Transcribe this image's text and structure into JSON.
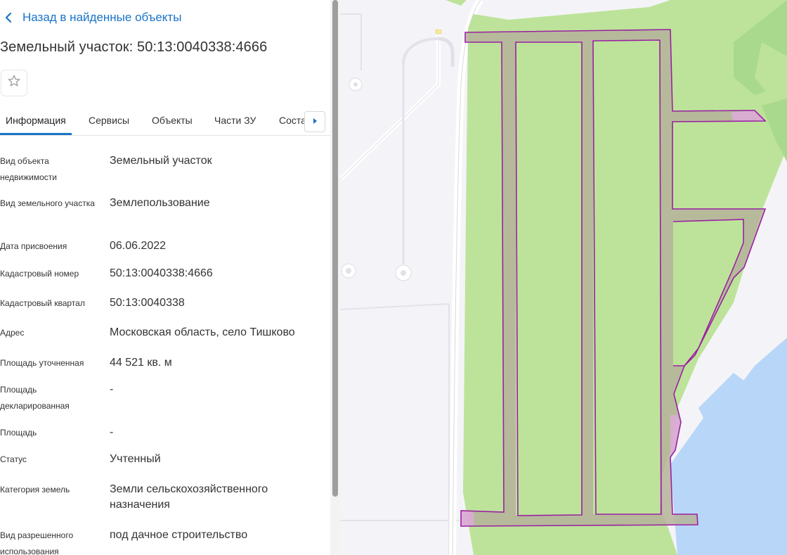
{
  "header": {
    "back_label": "Назад в найденные объекты",
    "title": "Земельный участок: 50:13:0040338:4666"
  },
  "tabs": [
    {
      "label": "Информация",
      "active": true
    },
    {
      "label": "Сервисы"
    },
    {
      "label": "Объекты"
    },
    {
      "label": "Части ЗУ"
    },
    {
      "label": "Соста"
    }
  ],
  "info": [
    {
      "label": "Вид объекта недвижимости",
      "value": "Земельный участок"
    },
    {
      "label": "Вид земельного участка",
      "value": "Землепользование"
    },
    {
      "label": "Дата присвоения",
      "value": "06.06.2022"
    },
    {
      "label": "Кадастровый номер",
      "value": "50:13:0040338:4666"
    },
    {
      "label": "Кадастровый квартал",
      "value": "50:13:0040338"
    },
    {
      "label": "Адрес",
      "value": "Московская область, село Тишково"
    },
    {
      "label": "Площадь уточненная",
      "value": "44 521 кв. м"
    },
    {
      "label": "Площадь декларированная",
      "value": "-"
    },
    {
      "label": "Площадь",
      "value": "-"
    },
    {
      "label": "Статус",
      "value": "Учтенный"
    },
    {
      "label": "Категория земель",
      "value": "Земли сельскохозяйственного назначения"
    },
    {
      "label": "Вид разрешенного использования",
      "value": "под дачное строительство"
    }
  ],
  "colors": {
    "accent": "#1a73c8",
    "parcel_outline": "#9b1fa3",
    "green_area": "#bde39a",
    "water": "#b8d6f7"
  },
  "icons": {
    "back": "chevron-left-icon",
    "favorite": "star-outline-icon",
    "tab_next": "caret-right-icon"
  }
}
